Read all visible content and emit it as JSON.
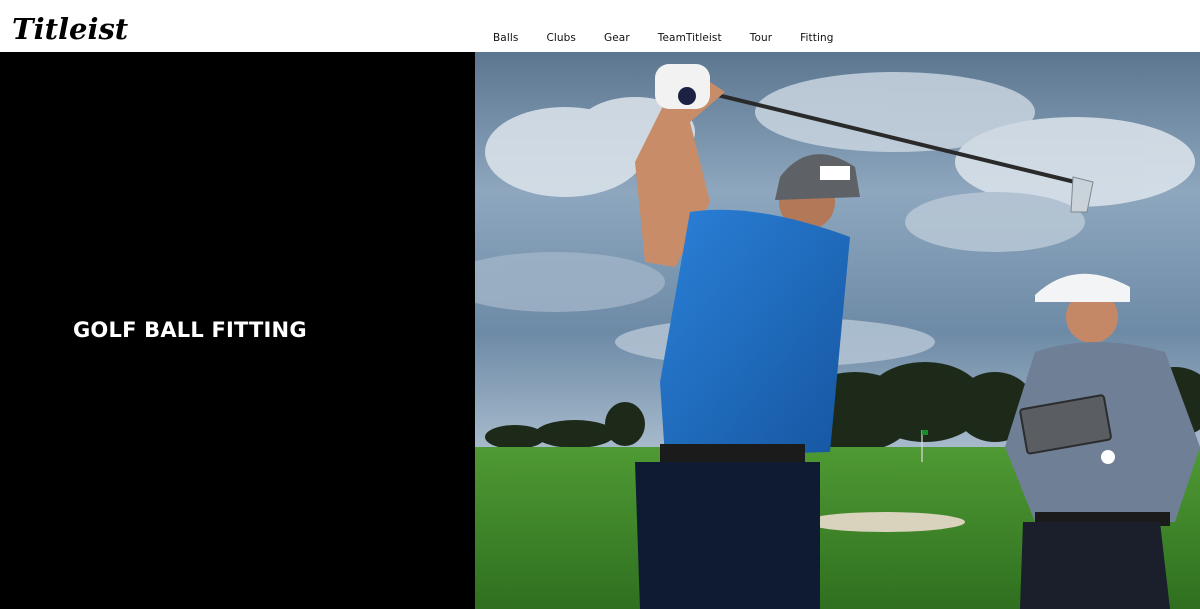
{
  "brand": {
    "logo_text": "Titleist"
  },
  "nav": {
    "items": [
      {
        "label": "Balls",
        "name": "nav-item-balls"
      },
      {
        "label": "Clubs",
        "name": "nav-item-clubs"
      },
      {
        "label": "Gear",
        "name": "nav-item-gear"
      },
      {
        "label": "TeamTitleist",
        "name": "nav-item-teamtitleist"
      },
      {
        "label": "Tour",
        "name": "nav-item-tour"
      },
      {
        "label": "Fitting",
        "name": "nav-item-fitting"
      }
    ]
  },
  "hero": {
    "title": "GOLF BALL FITTING"
  },
  "colors": {
    "panel": "#000000",
    "header_bg": "#ffffff",
    "shirt_blue": "#1e6bc0",
    "grass": "#3e8a2a",
    "sky": "#8ea7bf"
  }
}
